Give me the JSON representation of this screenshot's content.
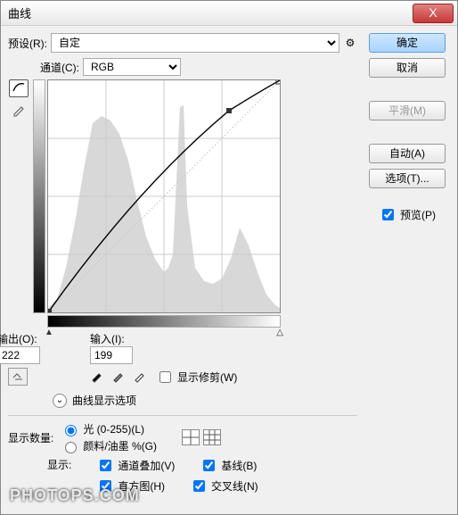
{
  "title": "曲线",
  "preset": {
    "label": "预设(R):",
    "value": "自定"
  },
  "gear_icon": "⚙",
  "buttons": {
    "ok": "确定",
    "cancel": "取消",
    "smooth": "平滑(M)",
    "auto": "自动(A)",
    "options": "选项(T)..."
  },
  "preview": {
    "label": "预览(P)",
    "checked": true
  },
  "channel": {
    "label": "通道(C):",
    "value": "RGB"
  },
  "output": {
    "label": "输出(O):",
    "value": "222"
  },
  "input": {
    "label": "输入(I):",
    "value": "199"
  },
  "show_clipping": {
    "label": "显示修剪(W)",
    "checked": false
  },
  "display_options_title": "曲线显示选项",
  "show_amount": {
    "label": "显示数量:",
    "opt_light": "光 (0-255)(L)",
    "opt_pigment": "颜料/油墨 %(G)",
    "selected": "light"
  },
  "show": {
    "label": "显示:",
    "channel_overlay": {
      "label": "通道叠加(V)",
      "checked": true
    },
    "baseline": {
      "label": "基线(B)",
      "checked": true
    },
    "histogram": {
      "label": "直方图(H)",
      "checked": true
    },
    "intersection": {
      "label": "交叉线(N)",
      "checked": true
    }
  },
  "close_x": "X",
  "chart_data": {
    "type": "line",
    "title": "Curves",
    "xlabel": "Input",
    "ylabel": "Output",
    "xlim": [
      0,
      255
    ],
    "ylim": [
      0,
      255
    ],
    "control_points": [
      {
        "x": 0,
        "y": 0
      },
      {
        "x": 199,
        "y": 222
      },
      {
        "x": 255,
        "y": 255
      }
    ],
    "histogram_shape": [
      0,
      10,
      40,
      90,
      160,
      210,
      220,
      200,
      170,
      130,
      90,
      60,
      45,
      50,
      80,
      240,
      70,
      40,
      30,
      35,
      60,
      90,
      70,
      40,
      20,
      10,
      5,
      2
    ]
  }
}
